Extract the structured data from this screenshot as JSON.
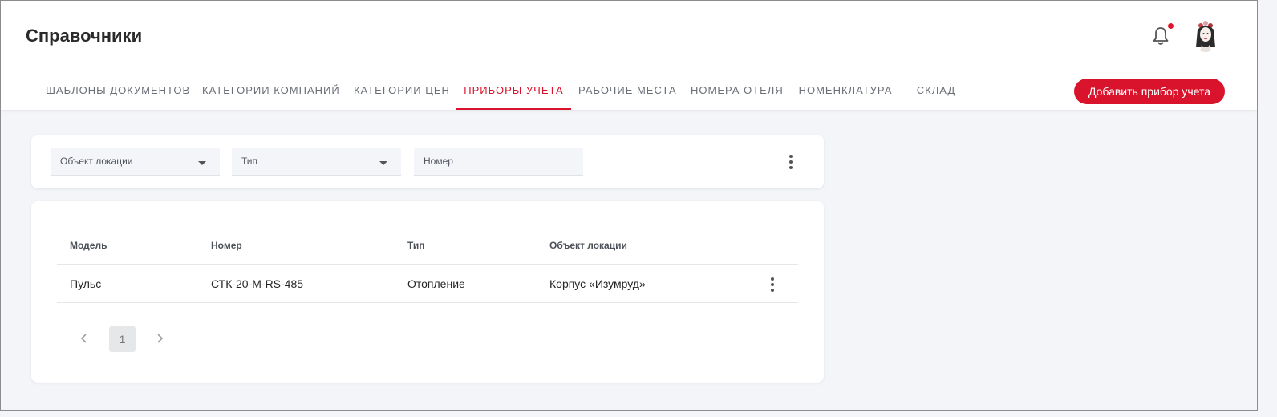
{
  "header": {
    "title": "Справочники",
    "notification_icon": "bell-icon",
    "notification_dot_color": "#e0142a"
  },
  "tabs": [
    {
      "label": "Шаблоны документов",
      "active": false
    },
    {
      "label": "Категории компаний",
      "active": false
    },
    {
      "label": "Категории цен",
      "active": false
    },
    {
      "label": "Приборы учета",
      "active": true
    },
    {
      "label": "Рабочие места",
      "active": false
    },
    {
      "label": "Номера отеля",
      "active": false
    },
    {
      "label": "Номенклатура",
      "active": false
    },
    {
      "label": "Склад",
      "active": false
    }
  ],
  "toolbar": {
    "add_label": "Добавить прибор учета",
    "accent_color": "#d9132c"
  },
  "filters": {
    "location": {
      "placeholder": "Объект локации"
    },
    "type": {
      "placeholder": "Тип"
    },
    "number": {
      "placeholder": "Номер"
    }
  },
  "table": {
    "columns": [
      "Модель",
      "Номер",
      "Тип",
      "Объект локации"
    ],
    "rows": [
      {
        "model": "Пульс",
        "number": "СТК-20-М-RS-485",
        "type": "Отопление",
        "location": "Корпус «Изумруд»"
      }
    ]
  },
  "pagination": {
    "current_page": "1"
  }
}
